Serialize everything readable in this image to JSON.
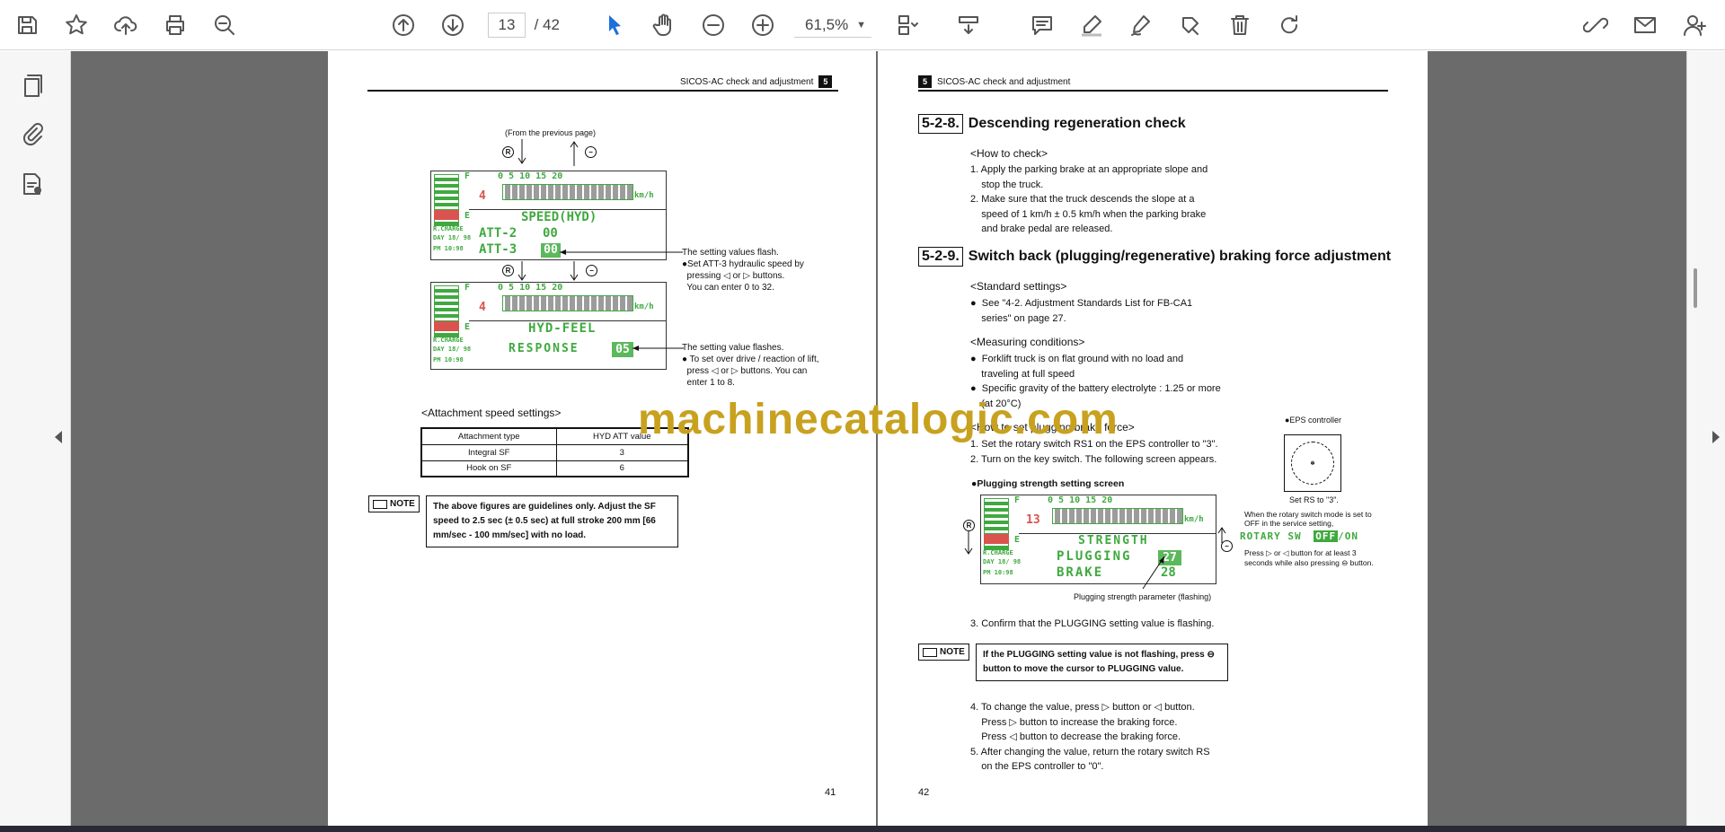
{
  "toolbar": {
    "page_current": "13",
    "page_sep": "/",
    "page_total": "42",
    "zoom": "61,5%",
    "icons": [
      "save-icon",
      "bookmark-star-icon",
      "upload-cloud-icon",
      "print-icon",
      "zoom-search-icon",
      "page-up-icon",
      "page-down-icon",
      "select-pointer-icon",
      "hand-icon",
      "zoom-out-icon",
      "zoom-in-icon",
      "page-fit-icon",
      "scroll-mode-icon",
      "comment-icon",
      "highlight-pen-icon",
      "draw-icon",
      "stamp-icon",
      "delete-icon",
      "redo-icon",
      "link-sign-icon",
      "mail-icon",
      "add-user-icon"
    ]
  },
  "left_page": {
    "header": "SICOS-AC check and adjustment",
    "chapter": "5",
    "page_number": "41",
    "from_prev": "(From the previous page)",
    "lcd1": {
      "title": "SPEED(HYD)",
      "row1_label": "ATT-2",
      "row1_val": "00",
      "row2_label": "ATT-3",
      "row2_val": "00",
      "digit": "4",
      "scale": "0   5   10   15   20",
      "unit": "km/h",
      "side1": "R.CHARGE",
      "side2": "DAY 18/ 98",
      "side3": "PM 10:98"
    },
    "lcd2": {
      "title": "HYD-FEEL",
      "row1_label": "RESPONSE",
      "row1_val": "05",
      "digit": "4",
      "scale": "0   5   10   15   20",
      "unit": "km/h",
      "side1": "R.CHARGE",
      "side2": "DAY 18/ 98",
      "side3": "PM 10:98"
    },
    "ann1_title": "The setting values flash.",
    "ann1_lines": [
      "●Set ATT-3 hydraulic speed by",
      "  pressing ◁ or ▷ buttons.",
      "  You can enter 0 to 32."
    ],
    "ann2_title": "The setting value flashes.",
    "ann2_lines": [
      "● To set over drive / reaction of lift,",
      "  press ◁ or ▷ buttons. You can",
      "  enter 1 to 8."
    ],
    "subhead": "<Attachment speed settings>",
    "table": {
      "headers": [
        "Attachment type",
        "HYD ATT value"
      ],
      "rows": [
        [
          "Integral SF",
          "3"
        ],
        [
          "Hook on SF",
          "6"
        ]
      ]
    },
    "note_label": "NOTE",
    "note_text": "The above figures are guidelines only. Adjust the SF speed to 2.5 sec (± 0.5 sec) at full stroke 200 mm [66 mm/sec - 100 mm/sec] with no load."
  },
  "right_page": {
    "header": "SICOS-AC check and adjustment",
    "chapter": "5",
    "page_number": "42",
    "sec1_num": "5-2-8.",
    "sec1_title": "Descending regeneration check",
    "how_to_check": "<How to check>",
    "check_steps": [
      "1. Apply the parking brake at an appropriate slope and",
      "    stop the truck.",
      "2. Make sure that the truck descends the slope at a",
      "    speed of 1 km/h ± 0.5 km/h when the parking brake",
      "    and brake pedal are released."
    ],
    "sec2_num": "5-2-9.",
    "sec2_title": "Switch back (plugging/regenerative) braking force adjustment",
    "std_settings": "<Standard settings>",
    "std_lines": [
      "●  See \"4-2. Adjustment Standards List for FB-CA1",
      "    series\" on page 27."
    ],
    "meas_cond": "<Measuring conditions>",
    "meas_lines": [
      "●  Forklift truck is on flat ground with no load and",
      "    traveling at full speed",
      "●  Specific gravity of the battery electrolyte : 1.25 or more",
      "    (at 20°C)"
    ],
    "how_to_set": "<How to set plugging brake force>",
    "set_steps": [
      "1. Set the rotary switch RS1 on the EPS controller to \"3\".",
      "2. Turn on the key switch. The following screen appears."
    ],
    "eps_label": "●EPS controller",
    "rs_caption": "Set RS to \"3\".",
    "plug_screen": "●Plugging strength setting screen",
    "lcd3": {
      "title": "STRENGTH",
      "row1_label": "PLUGGING",
      "row1_val": "27",
      "row2_label": "BRAKE",
      "row2_val": "28",
      "digit": "13",
      "scale": "0   5   10   15   20",
      "unit": "km/h",
      "side1": "R.CHARGE",
      "side2": "DAY 18/ 98",
      "side3": "PM 10:98"
    },
    "rotary_note": [
      "When the rotary switch mode is set to",
      "OFF in the service setting,"
    ],
    "rotary_sw": "ROTARY SW",
    "rotary_off": "OFF",
    "rotary_on": "/ON",
    "rotary_press": [
      "Press ▷ or ◁ button for at least 3",
      "seconds while also pressing ⊖ button."
    ],
    "plug_caption": "Plugging strength parameter (flashing)",
    "step3": "3. Confirm that the PLUGGING setting value is flashing.",
    "note_label": "NOTE",
    "note_text": "If the PLUGGING setting value is not flashing, press ⊖ button to move the cursor to PLUGGING value.",
    "final_steps": [
      "4. To change the value, press ▷ button or ◁ button.",
      "    Press ▷ button to increase the braking force.",
      "    Press ◁ button to decrease the braking force.",
      "5. After changing the value, return the rotary switch RS",
      "    on the EPS controller to \"0\"."
    ]
  },
  "watermark": "machinecatalogic.com",
  "colors": {
    "lcd_green": "#3fa93f",
    "watermark": "#c8a11f",
    "viewer_bg": "#6b6b6b"
  }
}
